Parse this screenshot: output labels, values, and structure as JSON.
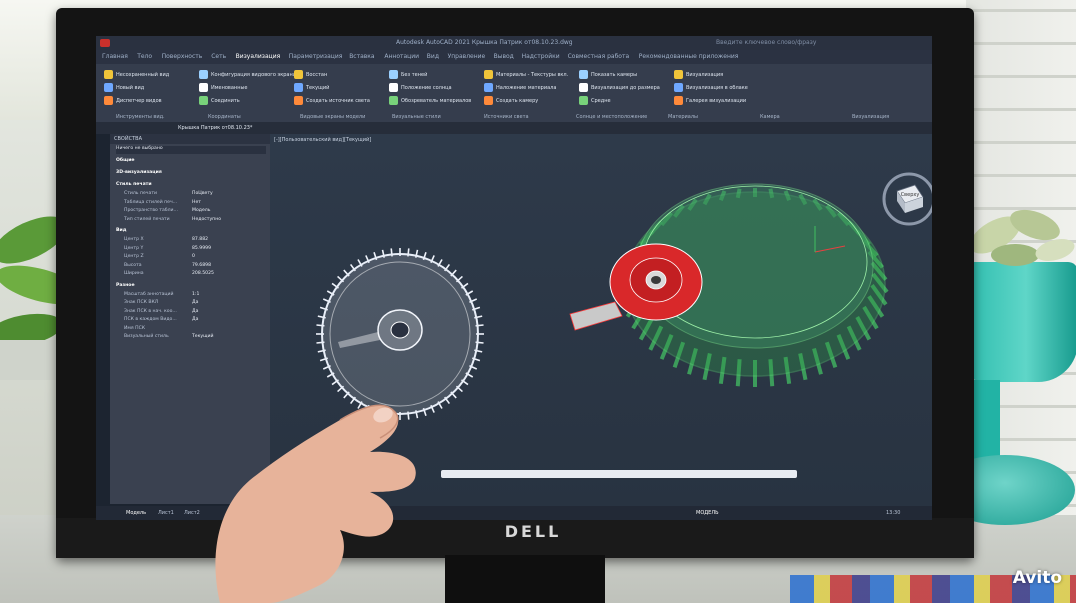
{
  "watermark": "Avito",
  "monitor": {
    "brand": "DELL"
  },
  "app": {
    "title": "Autodesk AutoCAD 2021   Крышка Патрик от08.10.23.dwg",
    "search_placeholder": "Введите ключевое слово/фразу",
    "tabs": [
      "Главная",
      "Тело",
      "Поверхность",
      "Сеть",
      "Визуализация",
      "Параметризация",
      "Вставка",
      "Аннотации",
      "Вид",
      "Управление",
      "Вывод",
      "Надстройки",
      "Совместная работа",
      "Рекомендованные приложения"
    ],
    "active_tab": "Визуализация",
    "ribbon": {
      "panel_labels": [
        "Инструменты вид.",
        "Координаты",
        "Видовые экраны модели",
        "Визуальные стили",
        "Источники света",
        "Солнце и местоположение",
        "Материалы",
        "Камера",
        "Визуализация"
      ],
      "buttons": [
        "Несохраненный вид",
        "Новый вид",
        "Диспетчер видов",
        "Конфигурация видового экрана",
        "Именованные",
        "Соединить",
        "Восстан",
        "Текущий",
        "Создать источник света",
        "Без теней",
        "Положение солнца",
        "Обозреватель материалов",
        "Материалы - Текстуры вкл.",
        "Наложение материала",
        "Создать камеру",
        "Показать камеры",
        "Визуализация до размера",
        "Средне",
        "Визуализация",
        "Визуализация в облаке",
        "Галерея визуализации"
      ]
    },
    "file_tab": "Крышка Патрик от08.10.23*",
    "viewport_label": "[-][Пользовательский вид][Текущий]",
    "properties": {
      "header": "СВОЙСТВА",
      "selection": "Ничего не выбрано",
      "sections": [
        {
          "title": "Общие",
          "rows": []
        },
        {
          "title": "3D-визуализация",
          "rows": []
        },
        {
          "title": "Стиль печати",
          "rows": [
            {
              "label": "Стиль печати",
              "value": "ПоЦвету"
            },
            {
              "label": "Таблица стилей печ...",
              "value": "Нет"
            },
            {
              "label": "Пространство табли...",
              "value": "Модель"
            },
            {
              "label": "Тип стилей печати",
              "value": "Недоступно"
            }
          ]
        },
        {
          "title": "Вид",
          "rows": [
            {
              "label": "Центр X",
              "value": "87.882"
            },
            {
              "label": "Центр Y",
              "value": "85.9999"
            },
            {
              "label": "Центр Z",
              "value": "0"
            },
            {
              "label": "Высота",
              "value": "79.6898"
            },
            {
              "label": "Ширина",
              "value": "208.5025"
            }
          ]
        },
        {
          "title": "Разное",
          "rows": [
            {
              "label": "Масштаб аннотаций",
              "value": "1:1"
            },
            {
              "label": "Знак ПСК ВКЛ",
              "value": "Да"
            },
            {
              "label": "Знак ПСК в нач. коо...",
              "value": "Да"
            },
            {
              "label": "ПСК в каждом Видо...",
              "value": "Да"
            },
            {
              "label": "Имя ПСК",
              "value": ""
            },
            {
              "label": "Визуальный стиль",
              "value": "Текущий"
            }
          ]
        }
      ]
    },
    "viewcube_face": "Сверху",
    "status": {
      "model_tab": "Модель",
      "layout1": "Лист1",
      "layout2": "Лист2",
      "model_label": "МОДЕЛЬ",
      "clock": "13:30"
    }
  },
  "colors": {
    "cap_green": "#3fbf5f",
    "hub_red": "#d9282a",
    "ribbon": "#353d4d",
    "viewport": "#2e3a4a"
  }
}
